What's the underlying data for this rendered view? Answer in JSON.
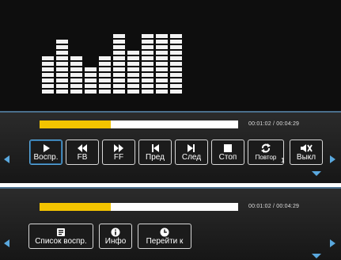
{
  "player": {
    "progress_fraction": 0.36,
    "time": "00:01:02 / 00:04:29",
    "equalizer_levels": [
      7,
      10,
      7,
      5,
      7,
      11,
      8,
      11,
      11,
      11
    ]
  },
  "controls": [
    {
      "label": "Воспр.",
      "icon": "play-icon",
      "selected": true
    },
    {
      "label": "FB",
      "icon": "fast-backward-icon"
    },
    {
      "label": "FF",
      "icon": "fast-forward-icon"
    },
    {
      "label": "Пред",
      "icon": "previous-track-icon"
    },
    {
      "label": "След",
      "icon": "next-track-icon"
    },
    {
      "label": "Стоп",
      "icon": "stop-icon"
    },
    {
      "label": "Повтор",
      "icon": "repeat-icon",
      "extra": "1"
    },
    {
      "label": "Выкл",
      "icon": "mute-icon"
    }
  ],
  "extra_controls": [
    {
      "label": "Список воспр.",
      "icon": "playlist-icon"
    },
    {
      "label": "Инфо",
      "icon": "info-icon"
    },
    {
      "label": "Перейти к",
      "icon": "clock-icon"
    }
  ],
  "colors": {
    "accent": "#5aa8de",
    "progress": "#f3c400",
    "background": "#141414"
  }
}
